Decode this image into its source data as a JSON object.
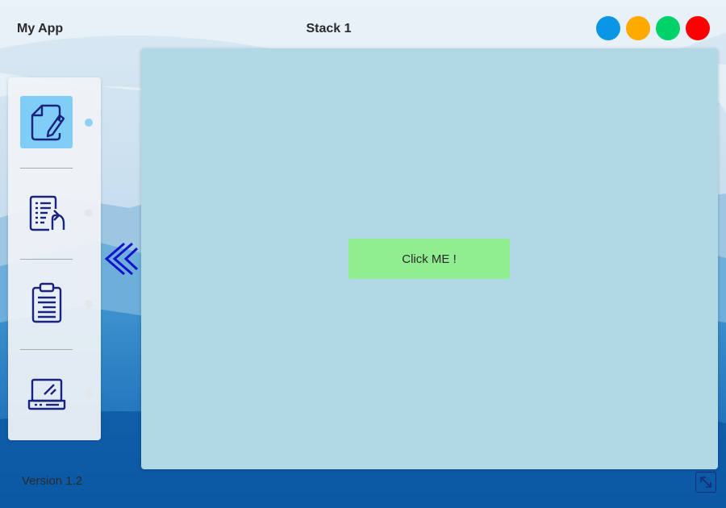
{
  "app": {
    "title": "My App",
    "stack_title": "Stack 1",
    "version": "Version 1.2"
  },
  "window_controls": [
    {
      "name": "blue",
      "color": "#0a96e6"
    },
    {
      "name": "orange",
      "color": "#ffaa00"
    },
    {
      "name": "green",
      "color": "#00d26a"
    },
    {
      "name": "red",
      "color": "#ff0000"
    }
  ],
  "sidebar": {
    "items": [
      {
        "icon": "document-edit-icon",
        "active": true
      },
      {
        "icon": "document-upload-icon",
        "active": false
      },
      {
        "icon": "clipboard-icon",
        "active": false
      },
      {
        "icon": "laptop-icon",
        "active": false
      }
    ]
  },
  "main": {
    "button_label": "Click ME !",
    "button_color": "#90ee90",
    "panel_color": "#b0d8e5"
  },
  "icons": {
    "collapse": "double-chevron-left-icon",
    "resize": "expand-diagonal-icon"
  }
}
